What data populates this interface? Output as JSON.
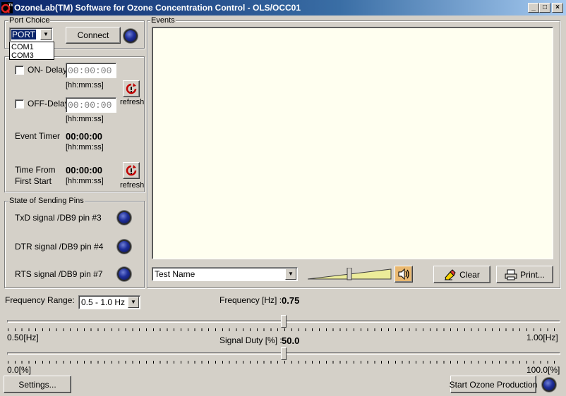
{
  "window": {
    "title": "OzoneLab(TM) Software for Ozone Concentration Control - OLS/OCC01",
    "minimize": "_",
    "maximize": "□",
    "close": "×"
  },
  "port_choice": {
    "group_label": "Port Choice",
    "selected": "PORT",
    "options": [
      "COM1",
      "COM3"
    ],
    "connect_label": "Connect"
  },
  "timers": {
    "on_delay_label": "ON- Delay",
    "on_delay_value": "00:00:00",
    "off_delay_label": "OFF-Delay",
    "off_delay_value": "00:00:00",
    "format_hint": "[hh:mm:ss]",
    "refresh_label": "refresh",
    "event_timer_label": "Event Timer",
    "event_timer_value": "00:00:00",
    "time_from_label_1": "Time From",
    "time_from_label_2": "First Start",
    "time_from_value": "00:00:00"
  },
  "pins": {
    "group_label": "State of Sending Pins",
    "txd": "TxD signal  /DB9 pin #3",
    "dtr": "DTR signal /DB9 pin #4",
    "rts": "RTS signal /DB9 pin #7"
  },
  "events": {
    "group_label": "Events",
    "test_name": "Test Name",
    "clear_label": "Clear",
    "print_label": "Print..."
  },
  "frequency": {
    "range_label": "Frequency Range:",
    "range_value": "0.5 - 1.0 Hz",
    "freq_label": "Frequency [Hz] :",
    "freq_value": "0.75",
    "min_label": "0.50[Hz]",
    "max_label": "1.00[Hz]",
    "freq_fraction": 0.5
  },
  "duty": {
    "label": "Signal Duty [%] :",
    "value": "50.0",
    "min_label": "0.0[%]",
    "max_label": "100.0[%]",
    "duty_fraction": 0.5
  },
  "footer": {
    "settings_label": "Settings...",
    "start_label": "Start Ozone Production"
  },
  "colors": {
    "face": "#d4d0c8",
    "events_bg": "#fffff0",
    "title_start": "#0a246a",
    "led_blue": "#1f2f9a"
  },
  "icons": {
    "refresh": "refresh-icon",
    "speaker": "speaker-icon",
    "eraser": "eraser-icon",
    "printer": "printer-icon"
  }
}
